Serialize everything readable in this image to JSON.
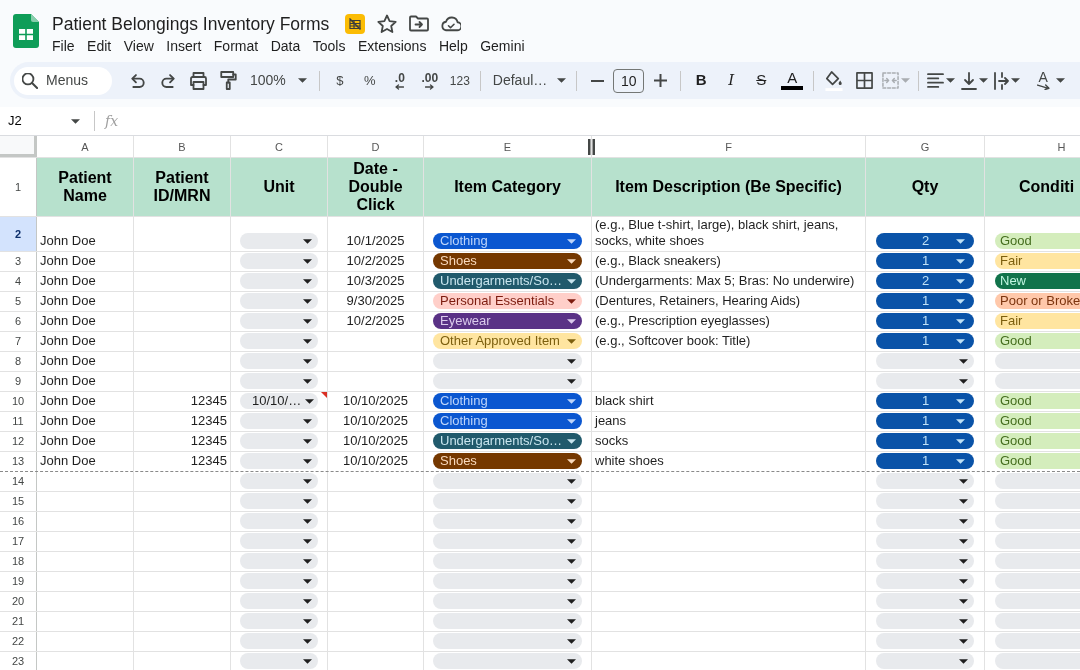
{
  "app": {
    "title": "Patient Belongings Inventory Forms"
  },
  "menu": [
    "File",
    "Edit",
    "View",
    "Insert",
    "Format",
    "Data",
    "Tools",
    "Extensions",
    "Help",
    "Gemini"
  ],
  "toolbar": {
    "search_menus": "Menus",
    "zoom": "100%",
    "number_formats": [
      {
        "kind": "currency",
        "label": "$"
      },
      {
        "kind": "percent",
        "label": "%"
      },
      {
        "kind": "decrease_decimal",
        "label": ".0"
      },
      {
        "kind": "increase_decimal",
        "label": ".00"
      },
      {
        "kind": "more",
        "label": "123"
      }
    ],
    "font": "Defaul…",
    "font_size": "10",
    "bold": "B",
    "italic": "I",
    "strikethrough": "S",
    "text_color": "A",
    "text_rotation": "A",
    "merge_disabled": true
  },
  "formula_bar": {
    "cell": "J2",
    "function_label": "fx"
  },
  "columns": [
    {
      "letter": "A",
      "heading": "Patient Name",
      "kind": "text"
    },
    {
      "letter": "B",
      "heading": "Patient ID/MRN",
      "kind": "number"
    },
    {
      "letter": "C",
      "heading": "Unit",
      "kind": "dropdown"
    },
    {
      "letter": "D",
      "heading": "Date - Double Click",
      "kind": "date"
    },
    {
      "letter": "E",
      "heading": "Item Category",
      "kind": "tag"
    },
    {
      "letter": "F",
      "heading": "Item Description (Be Specific)",
      "kind": "text"
    },
    {
      "letter": "G",
      "heading": "Qty",
      "kind": "count"
    },
    {
      "letter": "H",
      "heading": "Conditi",
      "kind": "tag"
    }
  ],
  "heading_row": {
    "number": "1",
    "selected": false
  },
  "rows": [
    {
      "number": "2",
      "selected": true,
      "break_before": false,
      "cells": {
        "A": "John Doe",
        "C": {
          "invalid": false
        },
        "D": "10/1/2025",
        "E": {
          "value": "Clothing",
          "color": "#0b57d0"
        },
        "F": "(e.g., Blue t-shirt, large), black shirt, jeans, socks, white shoes",
        "G": {
          "value": "2"
        },
        "H": {
          "value": "Good",
          "color": "#d4edbc"
        }
      }
    },
    {
      "number": "3",
      "selected": false,
      "break_before": false,
      "cells": {
        "A": "John Doe",
        "C": {
          "invalid": false
        },
        "D": "10/2/2025",
        "E": {
          "value": "Shoes",
          "color": "#753800"
        },
        "F": "(e.g., Black sneakers)",
        "G": {
          "value": "1"
        },
        "H": {
          "value": "Fair",
          "color": "#ffe5a0"
        }
      }
    },
    {
      "number": "4",
      "selected": false,
      "break_before": false,
      "cells": {
        "A": "John Doe",
        "C": {
          "invalid": false
        },
        "D": "10/3/2025",
        "E": {
          "value": "Undergarments/So…",
          "color": "#215a6c"
        },
        "F": "(Undergarments: Max 5; Bras: No underwire)",
        "G": {
          "value": "2"
        },
        "H": {
          "value": "New",
          "color": "#11734b"
        }
      }
    },
    {
      "number": "5",
      "selected": false,
      "break_before": false,
      "cells": {
        "A": "John Doe",
        "C": {
          "invalid": false
        },
        "D": "9/30/2025",
        "E": {
          "value": "Personal Essentials",
          "color": "#ffcfc9"
        },
        "F": "(Dentures, Retainers, Hearing Aids)",
        "G": {
          "value": "1"
        },
        "H": {
          "value": "Poor or Broke",
          "color": "#ffc8aa"
        }
      }
    },
    {
      "number": "6",
      "selected": false,
      "break_before": false,
      "cells": {
        "A": "John Doe",
        "C": {
          "invalid": false
        },
        "D": "10/2/2025",
        "E": {
          "value": "Eyewear",
          "color": "#5a3286"
        },
        "F": "(e.g., Prescription eyeglasses)",
        "G": {
          "value": "1"
        },
        "H": {
          "value": "Fair",
          "color": "#ffe5a0"
        }
      }
    },
    {
      "number": "7",
      "selected": false,
      "break_before": false,
      "cells": {
        "A": "John Doe",
        "C": {
          "invalid": false
        },
        "E": {
          "value": "Other Approved Item",
          "color": "#ffe5a0"
        },
        "F": "(e.g., Softcover book: Title)",
        "G": {
          "value": "1"
        },
        "H": {
          "value": "Good",
          "color": "#d4edbc"
        }
      }
    },
    {
      "number": "8",
      "selected": false,
      "break_before": false,
      "cells": {
        "A": "John Doe",
        "C": {
          "invalid": false
        }
      }
    },
    {
      "number": "9",
      "selected": false,
      "break_before": false,
      "cells": {
        "A": "John Doe",
        "C": {
          "invalid": false
        }
      }
    },
    {
      "number": "10",
      "selected": false,
      "break_before": false,
      "cells": {
        "A": "John Doe",
        "B": "12345",
        "C": {
          "value": "10/10/…",
          "invalid": true
        },
        "D": "10/10/2025",
        "E": {
          "value": "Clothing",
          "color": "#0b57d0"
        },
        "F": "black shirt",
        "G": {
          "value": "1"
        },
        "H": {
          "value": "Good",
          "color": "#d4edbc"
        }
      }
    },
    {
      "number": "11",
      "selected": false,
      "break_before": false,
      "cells": {
        "A": "John Doe",
        "B": "12345",
        "C": {
          "invalid": false
        },
        "D": "10/10/2025",
        "E": {
          "value": "Clothing",
          "color": "#0b57d0"
        },
        "F": "jeans",
        "G": {
          "value": "1"
        },
        "H": {
          "value": "Good",
          "color": "#d4edbc"
        }
      }
    },
    {
      "number": "12",
      "selected": false,
      "break_before": false,
      "cells": {
        "A": "John Doe",
        "B": "12345",
        "C": {
          "invalid": false
        },
        "D": "10/10/2025",
        "E": {
          "value": "Undergarments/So…",
          "color": "#215a6c"
        },
        "F": "socks",
        "G": {
          "value": "1"
        },
        "H": {
          "value": "Good",
          "color": "#d4edbc"
        }
      }
    },
    {
      "number": "13",
      "selected": false,
      "break_before": false,
      "cells": {
        "A": "John Doe",
        "B": "12345",
        "C": {
          "invalid": false
        },
        "D": "10/10/2025",
        "E": {
          "value": "Shoes",
          "color": "#753800"
        },
        "F": "white shoes",
        "G": {
          "value": "1"
        },
        "H": {
          "value": "Good",
          "color": "#d4edbc"
        }
      }
    },
    {
      "number": "14",
      "selected": false,
      "break_before": true,
      "cells": {
        "C": {
          "invalid": false
        }
      }
    },
    {
      "number": "15",
      "selected": false,
      "break_before": false,
      "cells": {
        "C": {
          "invalid": false
        }
      }
    },
    {
      "number": "16",
      "selected": false,
      "break_before": false,
      "cells": {
        "C": {
          "invalid": false
        }
      }
    },
    {
      "number": "17",
      "selected": false,
      "break_before": false,
      "cells": {
        "C": {
          "invalid": false
        }
      }
    },
    {
      "number": "18",
      "selected": false,
      "break_before": false,
      "cells": {
        "C": {
          "invalid": false
        }
      }
    },
    {
      "number": "19",
      "selected": false,
      "break_before": false,
      "cells": {
        "C": {
          "invalid": false
        }
      }
    },
    {
      "number": "20",
      "selected": false,
      "break_before": false,
      "cells": {
        "C": {
          "invalid": false
        }
      }
    },
    {
      "number": "21",
      "selected": false,
      "break_before": false,
      "cells": {
        "C": {
          "invalid": false
        }
      }
    },
    {
      "number": "22",
      "selected": false,
      "break_before": false,
      "cells": {
        "C": {
          "invalid": false
        }
      }
    },
    {
      "number": "23",
      "selected": false,
      "break_before": false,
      "cells": {
        "C": {
          "invalid": false
        }
      }
    }
  ]
}
